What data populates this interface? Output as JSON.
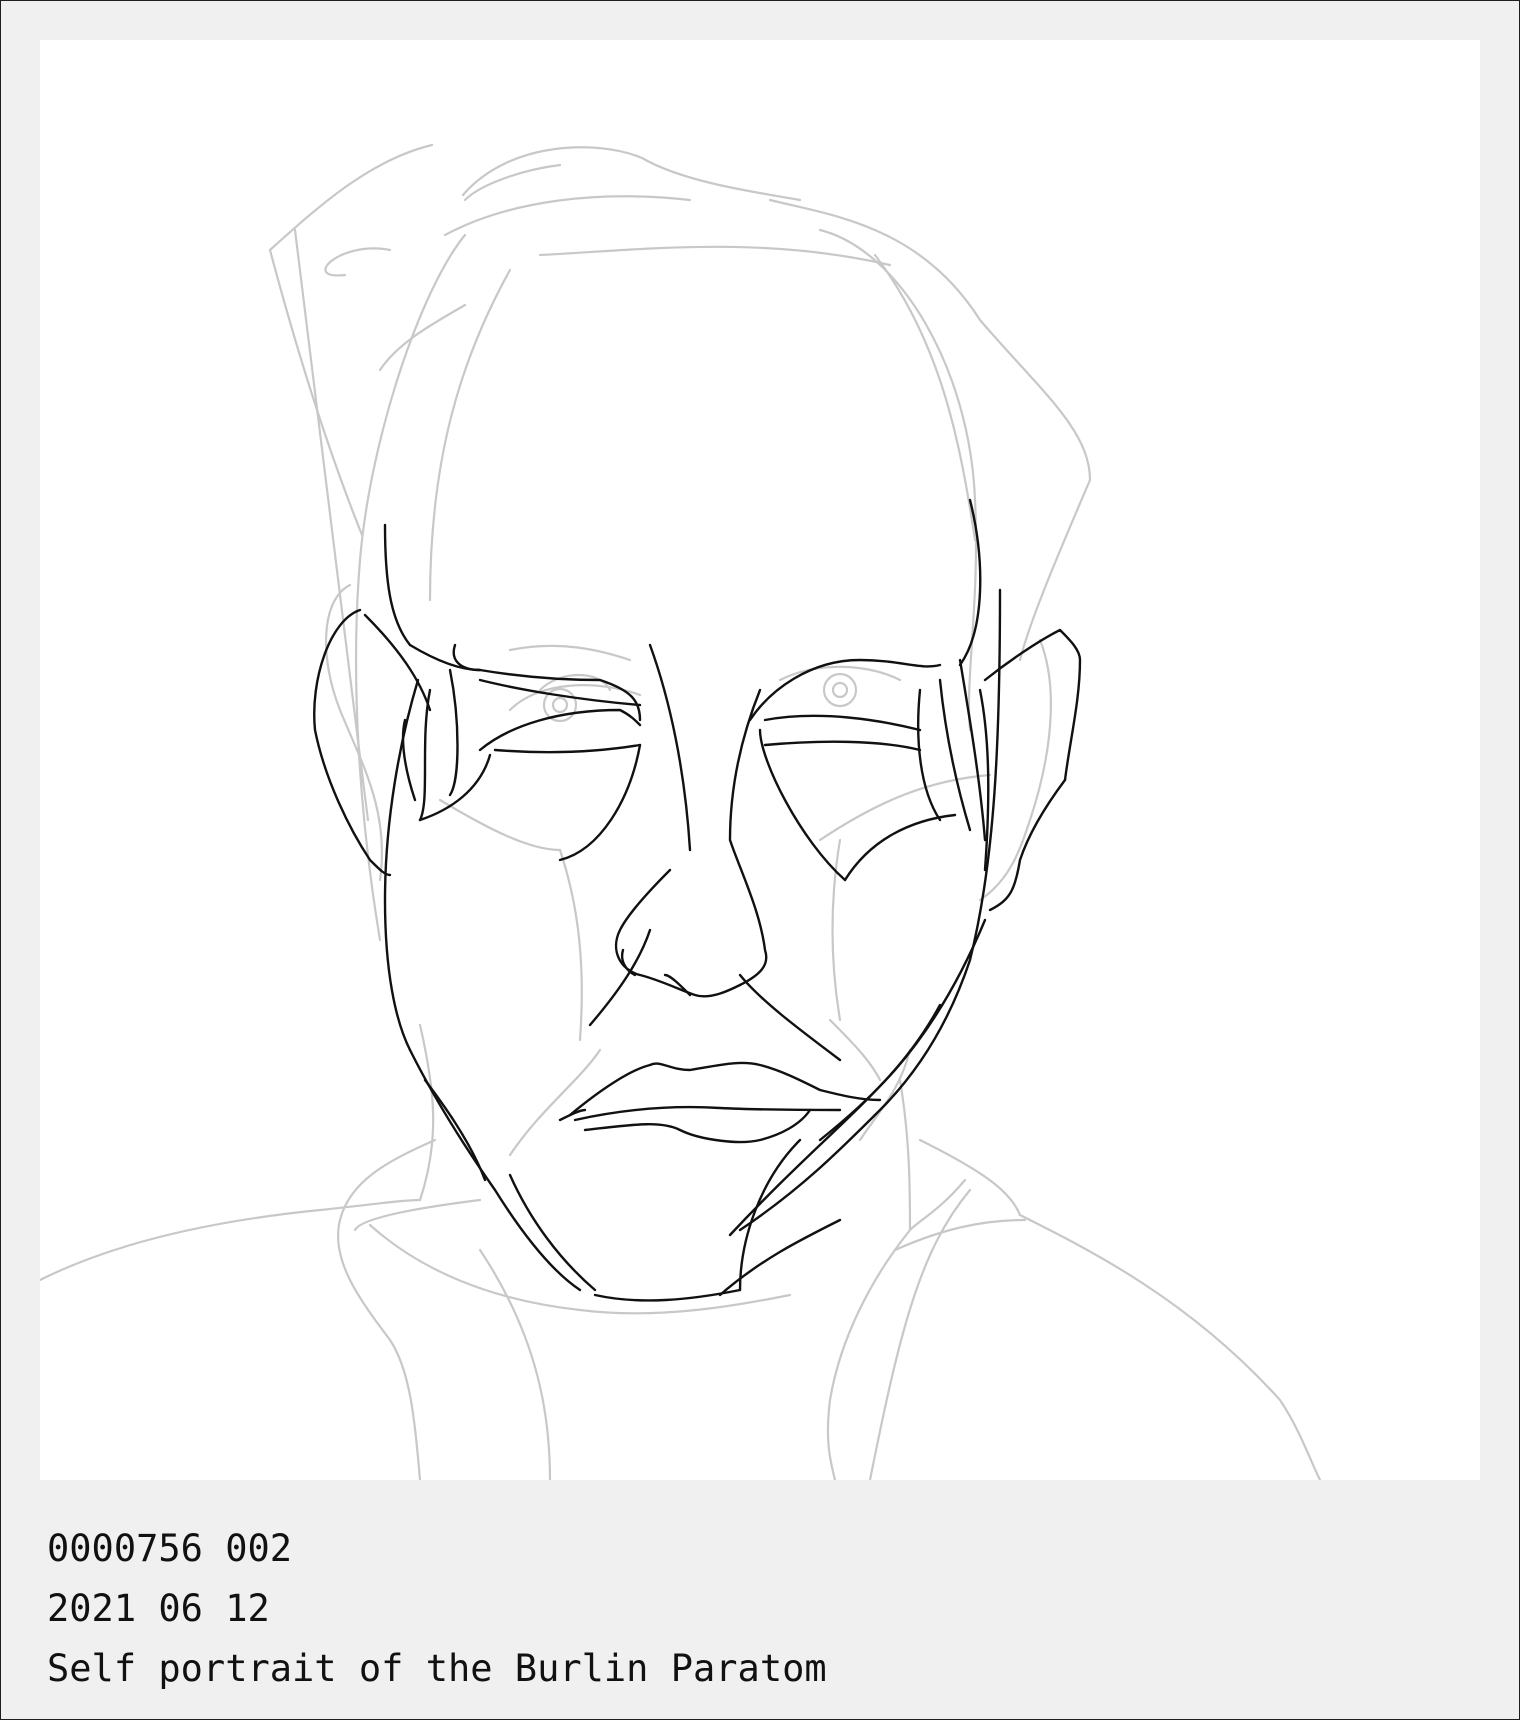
{
  "caption": {
    "id": "0000756 002",
    "date": "2021 06 12",
    "title": "Self portrait of the Burlin Paratom"
  },
  "artwork": {
    "subject_icon": "portrait-line-drawing",
    "ink_color": "#111111",
    "sketch_color": "#c8c8c8"
  }
}
